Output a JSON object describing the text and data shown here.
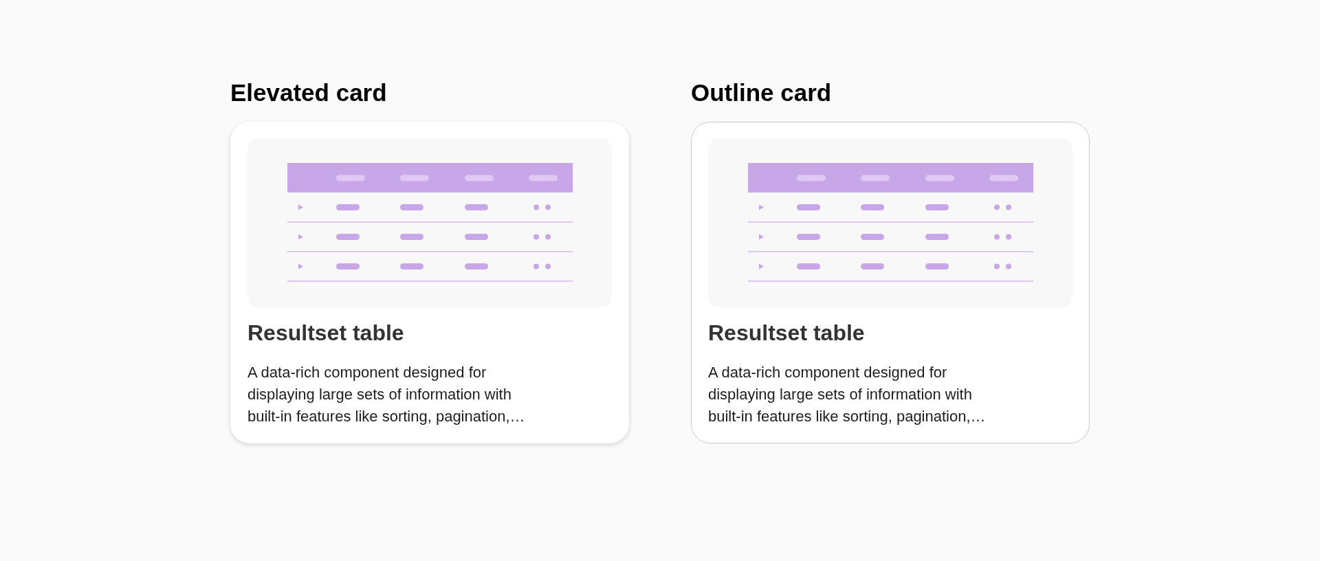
{
  "cards": [
    {
      "kind": "elevated",
      "heading": "Elevated card",
      "title": "Resultset table",
      "description": "A data-rich component designed for displaying large sets of information with built-in features like sorting, pagination,…"
    },
    {
      "kind": "outline",
      "heading": "Outline card",
      "title": "Resultset table",
      "description": "A data-rich component designed for displaying large sets of information with built-in features like sorting, pagination,…"
    }
  ]
}
